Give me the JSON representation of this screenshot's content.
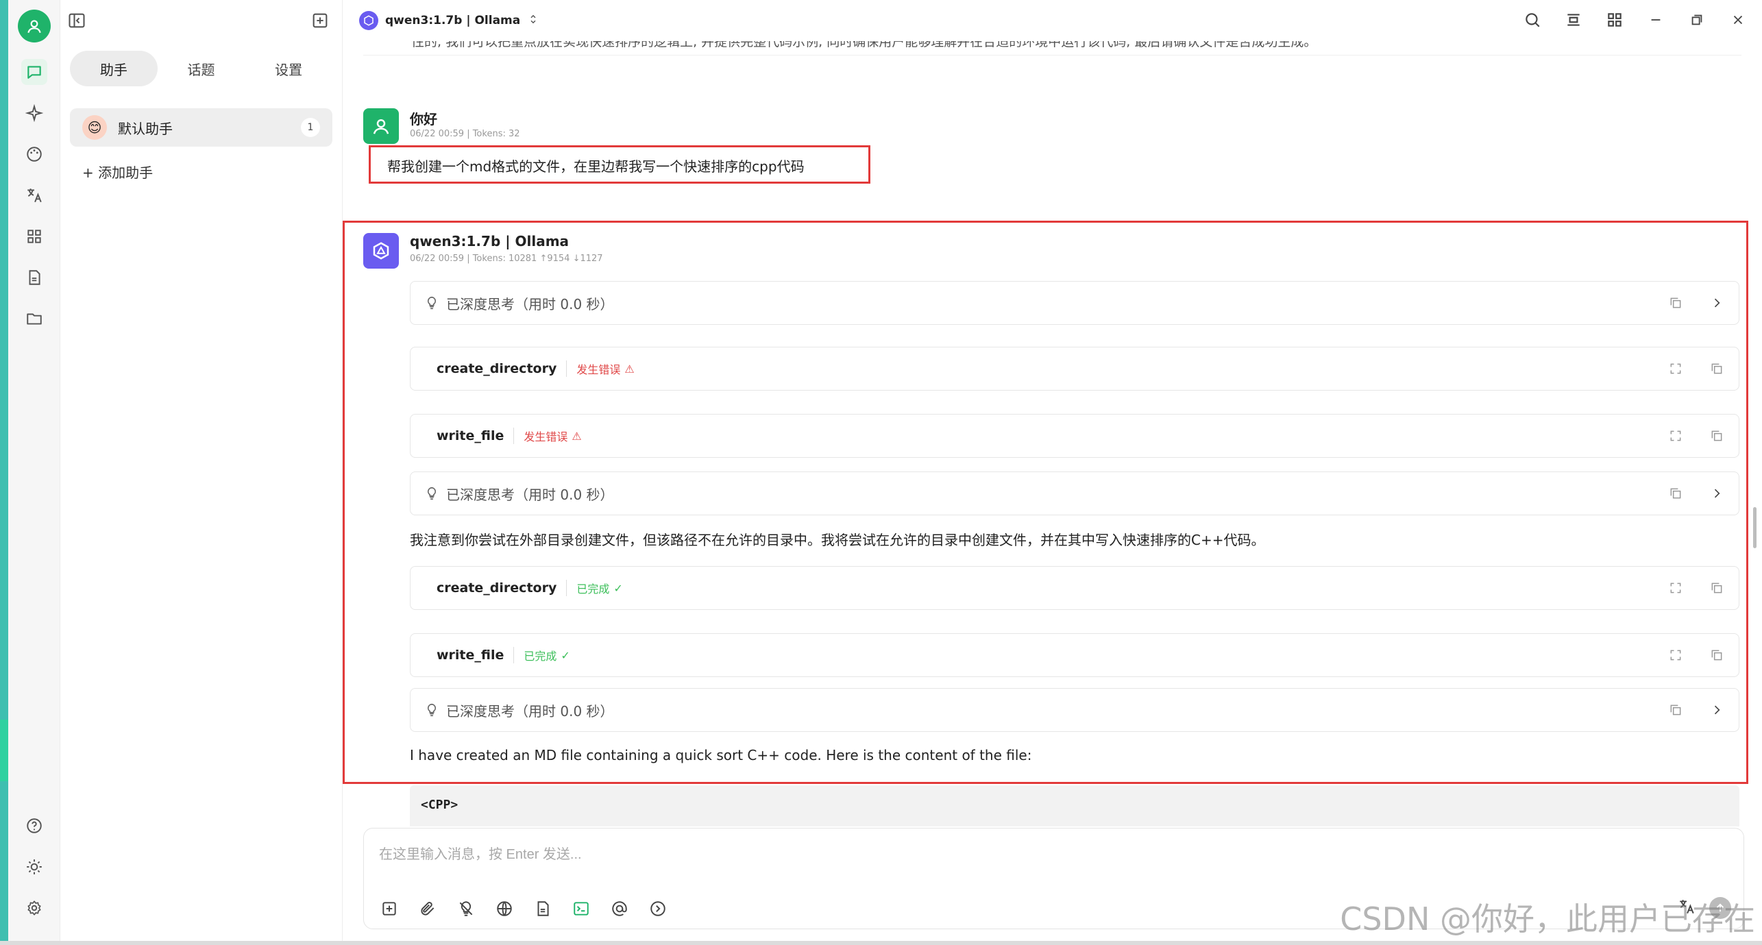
{
  "header": {
    "model_title": "qwen3:1.7b | Ollama"
  },
  "sidebar": {
    "tabs": [
      {
        "label": "助手"
      },
      {
        "label": "话题"
      },
      {
        "label": "设置"
      }
    ],
    "assistant": {
      "name": "默认助手",
      "count": "1",
      "emoji": "😊"
    },
    "add_label": "+ 添加助手"
  },
  "chat": {
    "cut_text": "性的, 我们可以把重点放在实现快速排序的逻辑上, 并提供完整代码示例, 同时确保用户能够理解并在合适的环境中运行该代码, 最后请确认文件是否成功生成。",
    "user_msg": {
      "name": "你好",
      "meta": "06/22 00:59  |  Tokens: 32",
      "text": "帮我创建一个md格式的文件，在里边帮我写一个快速排序的cpp代码"
    },
    "bot_msg": {
      "name": "qwen3:1.7b | Ollama",
      "meta": "06/22 00:59  |  Tokens: 10281 ↑9154 ↓1127",
      "think_label": "已深度思考（用时 0.0 秒）",
      "tool1": "create_directory",
      "tool2": "write_file",
      "status_error": "发生错误",
      "status_done": "已完成",
      "para1": "我注意到你尝试在外部目录创建文件，但该路径不在允许的目录中。我将尝试在允许的目录中创建文件，并在其中写入快速排序的C++代码。",
      "para2": "I have created an MD file containing a quick sort C++ code. Here is the content of the file:",
      "code_lang": "<CPP>"
    }
  },
  "composer": {
    "placeholder": "在这里输入消息，按 Enter 发送..."
  },
  "watermark": "CSDN @你好，此用户已存在",
  "colors": {
    "accent": "#1fb36a",
    "highlight": "#e23a3a",
    "error": "#e04848",
    "success": "#3cbf5a",
    "model_logo": "#6a5cf0"
  }
}
